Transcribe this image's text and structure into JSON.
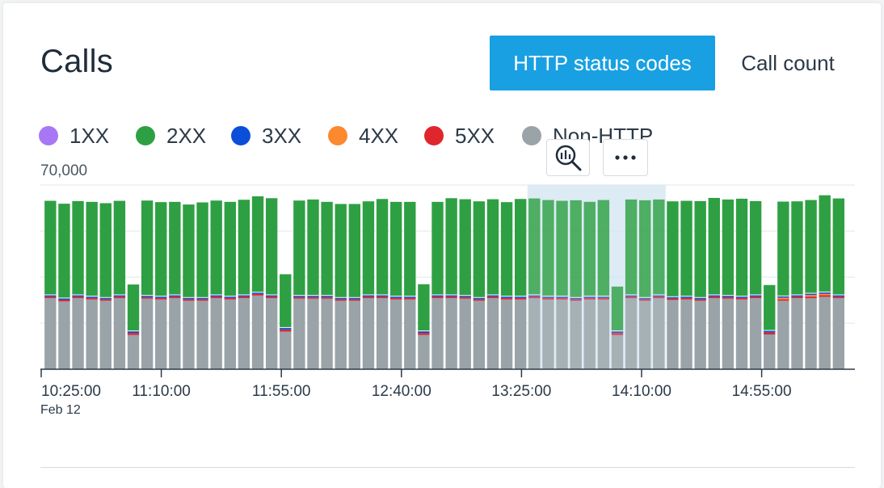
{
  "panel": {
    "title": "Calls",
    "tabs": [
      {
        "label": "HTTP status codes",
        "active": true
      },
      {
        "label": "Call count",
        "active": false
      }
    ],
    "toolbar": [
      {
        "icon": "zoom-chart-icon"
      },
      {
        "icon": "more-options-icon"
      }
    ]
  },
  "colors": {
    "1XX": "#a877f5",
    "2XX": "#2ea043",
    "3XX": "#0b4ed9",
    "4XX": "#fb8a2e",
    "5XX": "#e0262d",
    "Non-HTTP": "#9aa3a7",
    "accent": "#18a0e3",
    "selection": "#cfe3f1"
  },
  "chart_data": {
    "type": "bar",
    "stacked": true,
    "title": "",
    "ylim": [
      0,
      70000
    ],
    "y_top_label": "70,000",
    "grid": true,
    "legend": [
      "1XX",
      "2XX",
      "3XX",
      "4XX",
      "5XX",
      "Non-HTTP"
    ],
    "legend_position": "top",
    "x_tick_labels": [
      "10:25:00",
      "11:10:00",
      "11:55:00",
      "12:40:00",
      "13:25:00",
      "14:10:00",
      "14:55:00"
    ],
    "x_date_label": "Feb 12",
    "bar_interval_minutes": 5,
    "selection": {
      "from_bar": 35,
      "to_bar": 44
    },
    "series": [
      {
        "name": "Non-HTTP",
        "values": [
          27000,
          25800,
          27000,
          26500,
          26000,
          27000,
          13000,
          26800,
          26500,
          27000,
          26000,
          26000,
          27000,
          26500,
          27000,
          28000,
          27000,
          14300,
          26800,
          26800,
          26800,
          26000,
          26000,
          27000,
          27000,
          26500,
          26500,
          13000,
          27000,
          27000,
          26800,
          26000,
          27000,
          26500,
          26500,
          27000,
          26500,
          26500,
          26000,
          26500,
          26500,
          13000,
          27000,
          26000,
          27000,
          26300,
          26500,
          26000,
          27000,
          26800,
          26500,
          27000,
          13200,
          26000,
          27000,
          27000,
          27500,
          27000
        ]
      },
      {
        "name": "5XX",
        "values": [
          600,
          600,
          600,
          600,
          600,
          600,
          800,
          600,
          600,
          600,
          600,
          600,
          600,
          600,
          600,
          600,
          600,
          800,
          600,
          600,
          600,
          600,
          600,
          600,
          600,
          600,
          600,
          800,
          600,
          600,
          600,
          600,
          600,
          600,
          600,
          600,
          600,
          600,
          600,
          600,
          600,
          800,
          600,
          600,
          600,
          600,
          600,
          600,
          600,
          600,
          600,
          600,
          800,
          600,
          600,
          600,
          600,
          600
        ]
      },
      {
        "name": "4XX",
        "values": [
          0,
          0,
          0,
          0,
          0,
          0,
          0,
          0,
          0,
          0,
          0,
          0,
          0,
          0,
          0,
          0,
          0,
          0,
          0,
          0,
          0,
          0,
          0,
          0,
          0,
          0,
          0,
          0,
          0,
          0,
          0,
          0,
          0,
          0,
          0,
          0,
          0,
          0,
          0,
          0,
          0,
          0,
          0,
          0,
          0,
          0,
          0,
          0,
          0,
          0,
          0,
          0,
          0,
          600,
          0,
          600,
          600,
          0
        ]
      },
      {
        "name": "3XX",
        "values": [
          800,
          800,
          800,
          800,
          800,
          800,
          900,
          800,
          800,
          800,
          800,
          800,
          800,
          800,
          800,
          800,
          800,
          900,
          800,
          800,
          800,
          800,
          800,
          800,
          800,
          800,
          800,
          900,
          800,
          800,
          800,
          800,
          800,
          800,
          800,
          800,
          800,
          800,
          800,
          800,
          800,
          900,
          800,
          800,
          800,
          800,
          800,
          800,
          800,
          800,
          800,
          800,
          900,
          800,
          800,
          800,
          800,
          800
        ]
      },
      {
        "name": "2XX",
        "values": [
          35600,
          35700,
          35500,
          35700,
          35700,
          35600,
          17500,
          35900,
          35600,
          35200,
          35200,
          36000,
          35700,
          35700,
          36000,
          36300,
          36600,
          20100,
          35900,
          36300,
          35400,
          35400,
          35400,
          35400,
          36300,
          35700,
          35700,
          17600,
          35200,
          36600,
          36400,
          36400,
          36200,
          35600,
          36800,
          36500,
          36400,
          36100,
          36800,
          35700,
          36400,
          16700,
          36100,
          36800,
          36100,
          36100,
          36100,
          36500,
          36700,
          36300,
          36900,
          35500,
          17100,
          35700,
          35400,
          35300,
          36600,
          36500
        ]
      },
      {
        "name": "1XX",
        "values": [
          0,
          0,
          0,
          0,
          0,
          0,
          0,
          0,
          0,
          0,
          0,
          0,
          0,
          0,
          0,
          0,
          0,
          0,
          0,
          0,
          0,
          0,
          0,
          0,
          0,
          0,
          0,
          0,
          0,
          0,
          0,
          0,
          0,
          0,
          0,
          0,
          0,
          0,
          0,
          0,
          0,
          0,
          0,
          0,
          0,
          0,
          0,
          0,
          0,
          0,
          0,
          0,
          0,
          0,
          0,
          0,
          0,
          0
        ]
      }
    ]
  }
}
